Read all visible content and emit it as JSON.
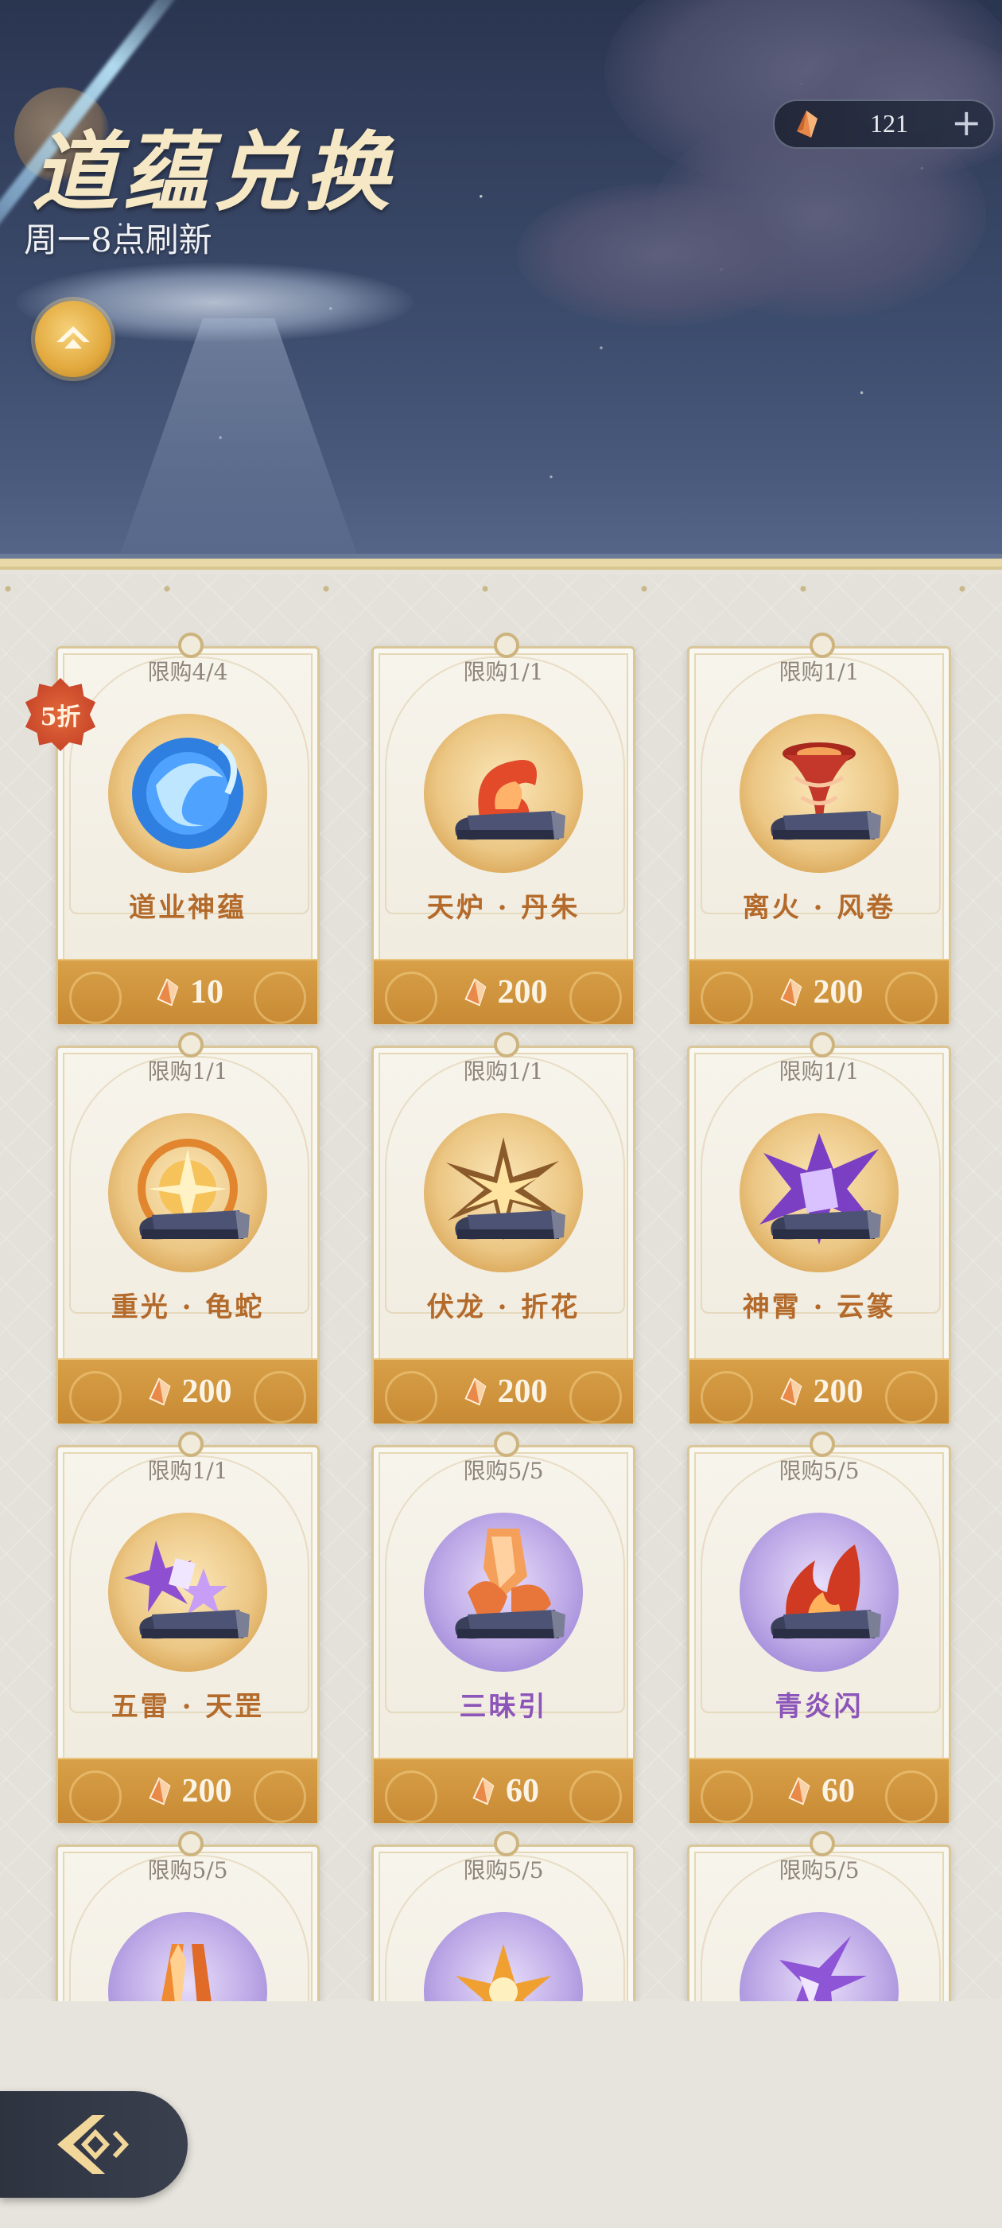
{
  "header": {
    "title": "道蕴兑换",
    "subtitle": "周一8点刷新",
    "currency": {
      "value": "121",
      "plus": "+"
    }
  },
  "discount_badge": "5折",
  "items": [
    {
      "limit": "限购4/4",
      "name": "道业神蕴",
      "price": "10",
      "theme": "gold"
    },
    {
      "limit": "限购1/1",
      "name": "天炉 · 丹朱",
      "price": "200",
      "theme": "gold"
    },
    {
      "limit": "限购1/1",
      "name": "离火 · 风卷",
      "price": "200",
      "theme": "gold"
    },
    {
      "limit": "限购1/1",
      "name": "重光 · 龟蛇",
      "price": "200",
      "theme": "gold"
    },
    {
      "limit": "限购1/1",
      "name": "伏龙 · 折花",
      "price": "200",
      "theme": "gold"
    },
    {
      "limit": "限购1/1",
      "name": "神霄 · 云篆",
      "price": "200",
      "theme": "gold"
    },
    {
      "limit": "限购1/1",
      "name": "五雷 · 天罡",
      "price": "200",
      "theme": "gold"
    },
    {
      "limit": "限购5/5",
      "name": "三昧引",
      "price": "60",
      "theme": "purple"
    },
    {
      "limit": "限购5/5",
      "name": "青炎闪",
      "price": "60",
      "theme": "purple"
    },
    {
      "limit": "限购5/5",
      "name": "",
      "price": "",
      "theme": "purple"
    },
    {
      "limit": "限购5/5",
      "name": "",
      "price": "",
      "theme": "purple"
    },
    {
      "limit": "限购5/5",
      "name": "",
      "price": "",
      "theme": "purple"
    }
  ],
  "colors": {
    "accent_gold": "#c88a34",
    "name_gold": "#b36a2a",
    "name_purple": "#8c55b9",
    "badge_red": "#c9462a"
  },
  "icons": {
    "currency": "crystal-shard-icon",
    "up_button": "ascend-arrow-icon",
    "back": "back-arrow-icon"
  }
}
